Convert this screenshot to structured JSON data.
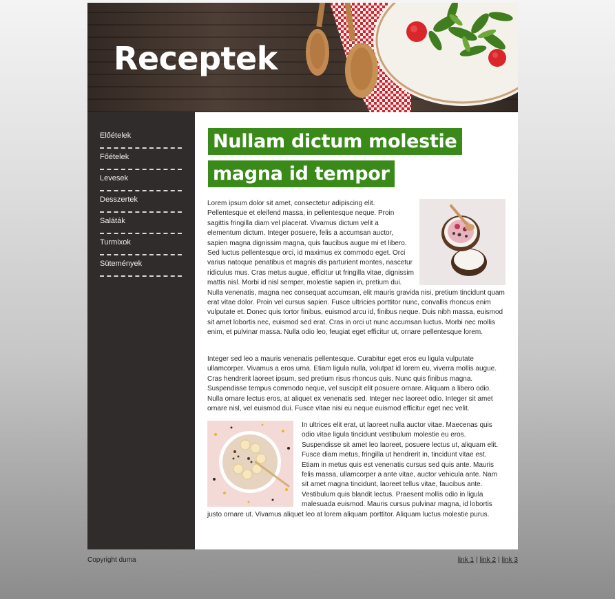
{
  "header": {
    "title": "Receptek"
  },
  "sidebar": {
    "items": [
      {
        "label": "Előételek"
      },
      {
        "label": "Főételek"
      },
      {
        "label": "Levesek"
      },
      {
        "label": "Desszertek"
      },
      {
        "label": "Saláták"
      },
      {
        "label": "Turmixok"
      },
      {
        "label": "Sütemények"
      }
    ]
  },
  "main": {
    "headline_line1": "Nullam dictum molestie",
    "headline_line2": "magna id tempor",
    "paragraphs": [
      "Lorem ipsum dolor sit amet, consectetur adipiscing elit. Pellentesque et eleifend massa, in pellentesque neque. Proin sagittis fringilla diam vel placerat. Vivamus dictum velit a elementum dictum. Integer posuere, felis a accumsan auctor, sapien magna dignissim magna, quis faucibus augue mi et libero. Sed luctus pellentesque orci, id maximus ex commodo eget. Orci varius natoque penatibus et magnis dis parturient montes, nascetur ridiculus mus. Cras metus augue, efficitur ut fringilla vitae, dignissim mattis nisl. Morbi id nisl semper, molestie sapien in, pretium dui. Nulla venenatis, magna nec consequat accumsan, elit mauris gravida nisi, pretium tincidunt quam erat vitae dolor. Proin vel cursus sapien. Fusce ultricies porttitor nunc, convallis rhoncus enim vulputate et. Donec quis tortor finibus, euismod arcu id, finibus neque. Duis nibh massa, euismod sit amet lobortis nec, euismod sed erat. Cras in orci ut nunc accumsan luctus. Morbi nec mollis enim, et pulvinar massa. Nulla odio leo, feugiat eget efficitur ut, ornare pellentesque lorem.",
      "Integer sed leo a mauris venenatis pellentesque. Curabitur eget eros eu ligula vulputate ullamcorper. Vivamus a eros urna. Etiam ligula nulla, volutpat id lorem eu, viverra mollis augue. Cras hendrerit laoreet ipsum, sed pretium risus rhoncus quis. Nunc quis finibus magna. Suspendisse tempus commodo neque, vel suscipit elit posuere ornare. Aliquam a libero odio. Nulla ornare lectus eros, at aliquet ex venenatis sed. Integer nec laoreet odio. Integer sit amet ornare nisl, vel euismod dui. Fusce vitae nisi eu neque euismod efficitur eget nec velit.",
      "In ultrices elit erat, ut laoreet nulla auctor vitae. Maecenas quis odio vitae ligula tincidunt vestibulum molestie eu eros. Suspendisse sit amet leo laoreet, posuere lectus ut, aliquam elit. Fusce diam metus, fringilla ut hendrerit in, tincidunt vitae est. Etiam in metus quis est venenatis cursus sed quis ante. Mauris felis massa, ullamcorper a ante vitae, auctor vehicula ante. Nam sit amet magna tincidunt, laoreet tellus vitae, faucibus ante. Vestibulum quis blandit lectus. Praesent mollis odio in ligula malesuada euismod. Mauris cursus pulvinar magna, id lobortis justo ornare ut. Vivamus aliquet leo at lorem aliquam porttitor. Aliquam luctus molestie purus."
    ]
  },
  "footer": {
    "copyright": "Copyright duma",
    "links": [
      {
        "label": "link 1"
      },
      {
        "label": "link 2"
      },
      {
        "label": "link 3"
      }
    ],
    "separator": "|"
  },
  "colors": {
    "headline_bg": "#3a8a1a",
    "sidebar_bg": "#302c2b",
    "content_bg": "#ffffff"
  }
}
